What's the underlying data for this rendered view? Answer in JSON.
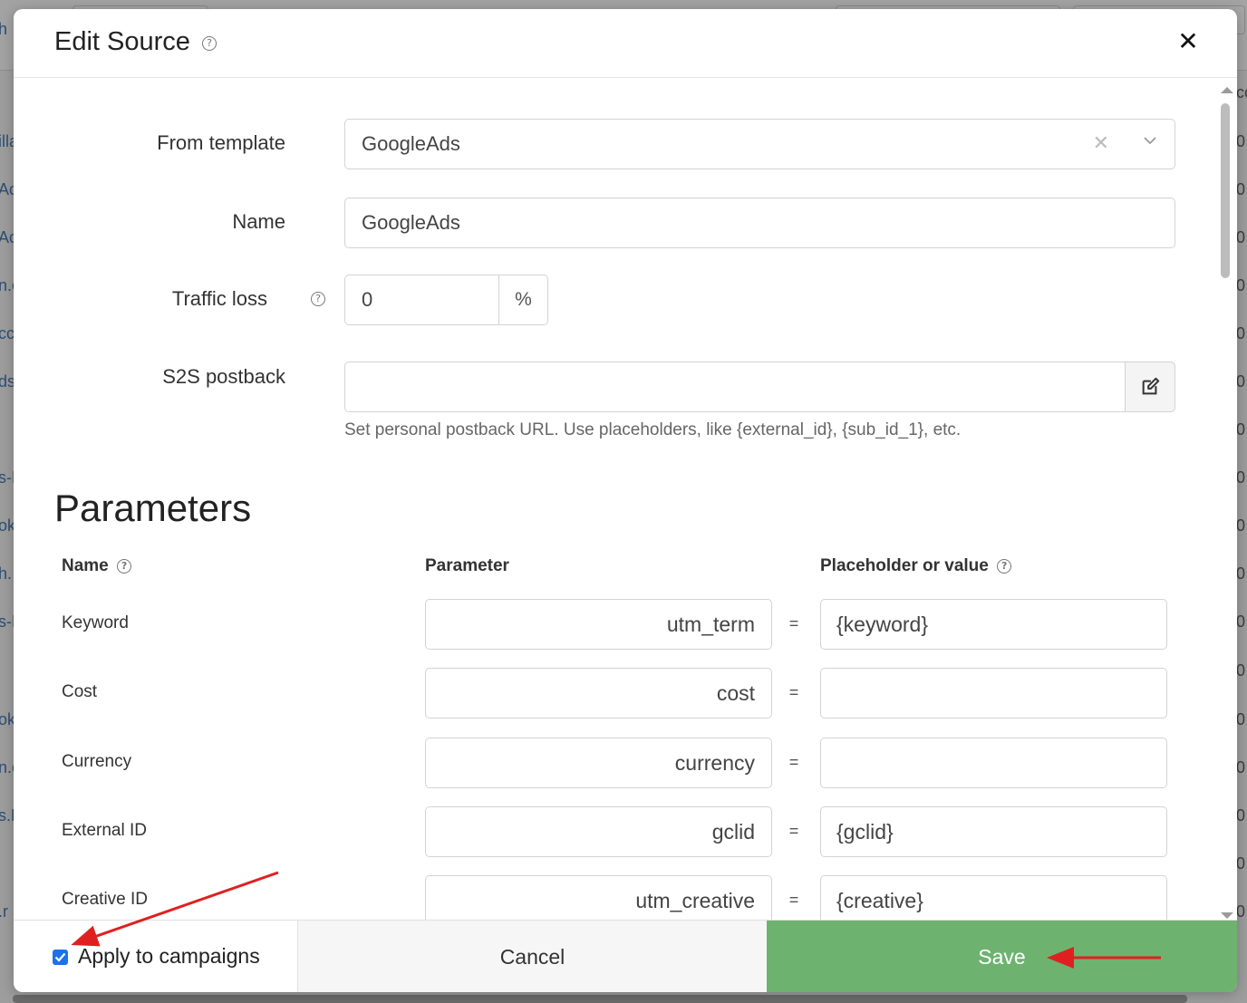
{
  "background": {
    "left_fragments": [
      "h",
      "illa",
      "Ac",
      "Ac",
      "n.c",
      "cc",
      "ds",
      "s-F",
      "ok",
      "h.",
      "s-F",
      "ok",
      "n.c",
      "s.N",
      ".r"
    ],
    "right_fragments": [
      "co",
      "0",
      "0",
      "0",
      "0",
      "0",
      "0",
      "0",
      "0",
      "0",
      "0",
      "0",
      "0",
      "0",
      "0",
      "0",
      "0",
      "0"
    ]
  },
  "modal": {
    "title": "Edit Source",
    "title_help": "?",
    "close_symbol": "✕"
  },
  "form": {
    "template": {
      "label": "From template",
      "value": "GoogleAds",
      "clear_symbol": "✕"
    },
    "name": {
      "label": "Name",
      "value": "GoogleAds"
    },
    "traffic_loss": {
      "label": "Traffic loss",
      "help": "?",
      "value": "0",
      "unit": "%"
    },
    "postback": {
      "label": "S2S postback",
      "value": "",
      "help_text": "Set personal postback URL. Use placeholders, like {external_id}, {sub_id_1}, etc."
    }
  },
  "parameters": {
    "title": "Parameters",
    "columns": {
      "name": "Name",
      "parameter": "Parameter",
      "placeholder": "Placeholder or value"
    },
    "help": "?",
    "equals": "=",
    "rows": [
      {
        "name": "Keyword",
        "parameter": "utm_term",
        "value": "{keyword}"
      },
      {
        "name": "Cost",
        "parameter": "cost",
        "value": ""
      },
      {
        "name": "Currency",
        "parameter": "currency",
        "value": ""
      },
      {
        "name": "External ID",
        "parameter": "gclid",
        "value": "{gclid}"
      },
      {
        "name": "Creative ID",
        "parameter": "utm_creative",
        "value": "{creative}"
      }
    ]
  },
  "footer": {
    "apply_label": "Apply to campaigns",
    "apply_checked": true,
    "cancel_label": "Cancel",
    "save_label": "Save"
  },
  "colors": {
    "save_button": "#6db36f",
    "checkbox": "#1a73e8",
    "annotation_arrow": "#e02020"
  }
}
